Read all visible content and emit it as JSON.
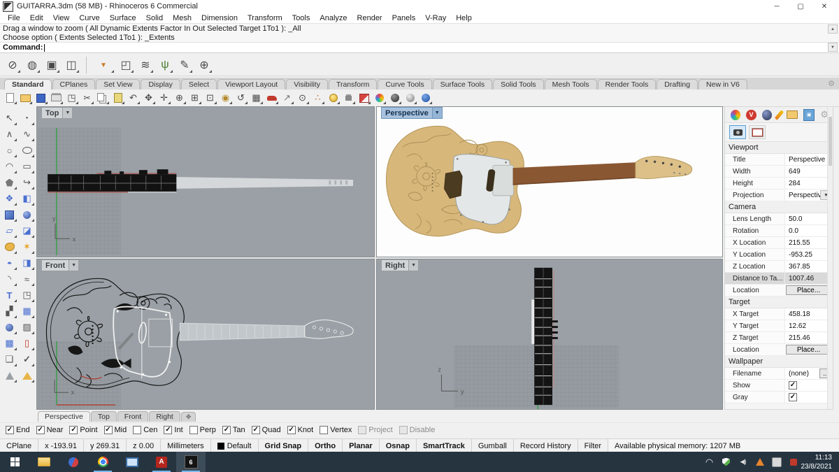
{
  "window": {
    "title": "GUITARRA.3dm (58 MB) - Rhinoceros 6 Commercial"
  },
  "menu": {
    "items": [
      "File",
      "Edit",
      "View",
      "Curve",
      "Surface",
      "Solid",
      "Mesh",
      "Dimension",
      "Transform",
      "Tools",
      "Analyze",
      "Render",
      "Panels",
      "V-Ray",
      "Help"
    ]
  },
  "command": {
    "history_line1": "Drag a window to zoom ( All Dynamic Extents Factor In Out Selected Target 1To1 ): _All",
    "history_line2": "Choose option ( Extents Selected 1To1 ): _Extents",
    "prompt": "Command:"
  },
  "toolbar_tabs": {
    "active": "Standard",
    "items": [
      "Standard",
      "CPlanes",
      "Set View",
      "Display",
      "Select",
      "Viewport Layout",
      "Visibility",
      "Transform",
      "Curve Tools",
      "Surface Tools",
      "Solid Tools",
      "Mesh Tools",
      "Render Tools",
      "Drafting",
      "New in V6"
    ]
  },
  "toolbar1": {
    "icons": [
      "circle-slash",
      "render-teapot",
      "render-frame",
      "viewport-display",
      "selection-filter",
      "box-edit",
      "workbench",
      "grass",
      "pen",
      "zoom-target"
    ]
  },
  "toolbar2": {
    "icons": [
      "new-file",
      "open-file",
      "save",
      "print",
      "export",
      "cut",
      "copy",
      "paste",
      "undo",
      "pan",
      "move",
      "zoom-extents",
      "zoom-window",
      "zoom-selected",
      "zoom-lens",
      "rotate-view",
      "viewport-layout",
      "named-view",
      "distance",
      "circle-center",
      "point-analysis",
      "lamp",
      "lock",
      "vray-box",
      "color-wheel",
      "sphere-dark",
      "sphere-gray",
      "sphere-blue"
    ]
  },
  "left_toolbar": {
    "rows": [
      [
        "select",
        "point"
      ],
      [
        "polyline",
        "curve"
      ],
      [
        "circle",
        "ellipse"
      ],
      [
        "arc",
        "rectangle"
      ],
      [
        "polygon",
        "helix"
      ],
      [
        "surface-points",
        "surface-blend"
      ],
      [
        "box",
        "sphere"
      ],
      [
        "plane",
        "patch"
      ],
      [
        "blob",
        "splash"
      ],
      [
        "extrude",
        "extrude-surface"
      ],
      [
        "fillet",
        "blend"
      ],
      [
        "text",
        "move-points"
      ],
      [
        "blocks",
        "array"
      ],
      [
        "solid-union",
        "hatch"
      ],
      [
        "grid-panel",
        "clamp"
      ],
      [
        "layers",
        "check"
      ],
      [
        "cone",
        "pyramid"
      ]
    ]
  },
  "viewports": {
    "top": {
      "label": "Top"
    },
    "perspective": {
      "label": "Perspective"
    },
    "front": {
      "label": "Front"
    },
    "right": {
      "label": "Right"
    }
  },
  "panel": {
    "tabs": [
      "properties",
      "vray",
      "display",
      "notes",
      "libraries",
      "rendering"
    ],
    "viewport": {
      "title": "Viewport",
      "rows": [
        {
          "label": "Title",
          "value": "Perspective"
        },
        {
          "label": "Width",
          "value": "649"
        },
        {
          "label": "Height",
          "value": "284"
        },
        {
          "label": "Projection",
          "value": "Perspective"
        }
      ]
    },
    "camera": {
      "title": "Camera",
      "rows": [
        {
          "label": "Lens Length",
          "value": "50.0"
        },
        {
          "label": "Rotation",
          "value": "0.0"
        },
        {
          "label": "X Location",
          "value": "215.55"
        },
        {
          "label": "Y Location",
          "value": "-953.25"
        },
        {
          "label": "Z Location",
          "value": "367.85"
        },
        {
          "label": "Distance to Ta...",
          "value": "1007.46"
        },
        {
          "label": "Location",
          "value": "Place..."
        }
      ]
    },
    "target": {
      "title": "Target",
      "rows": [
        {
          "label": "X Target",
          "value": "458.18"
        },
        {
          "label": "Y Target",
          "value": "12.62"
        },
        {
          "label": "Z Target",
          "value": "215.46"
        },
        {
          "label": "Location",
          "value": "Place..."
        }
      ]
    },
    "wallpaper": {
      "title": "Wallpaper",
      "rows": [
        {
          "label": "Filename",
          "value": "(none)",
          "more": "..."
        },
        {
          "label": "Show",
          "checked": true
        },
        {
          "label": "Gray",
          "checked": true
        }
      ]
    }
  },
  "viewport_tabs": {
    "items": [
      {
        "label": "Perspective",
        "active": true
      },
      {
        "label": "Top",
        "active": false
      },
      {
        "label": "Front",
        "active": false
      },
      {
        "label": "Right",
        "active": false
      }
    ]
  },
  "osnap": {
    "items": [
      {
        "label": "End",
        "checked": true
      },
      {
        "label": "Near",
        "checked": true
      },
      {
        "label": "Point",
        "checked": true
      },
      {
        "label": "Mid",
        "checked": true
      },
      {
        "label": "Cen",
        "checked": false
      },
      {
        "label": "Int",
        "checked": true
      },
      {
        "label": "Perp",
        "checked": false
      },
      {
        "label": "Tan",
        "checked": true
      },
      {
        "label": "Quad",
        "checked": true
      },
      {
        "label": "Knot",
        "checked": true
      },
      {
        "label": "Vertex",
        "checked": false
      },
      {
        "label": "Project",
        "checked": false,
        "disabled": true
      },
      {
        "label": "Disable",
        "checked": false,
        "disabled": true
      }
    ]
  },
  "statusbar": {
    "items": [
      {
        "label": "CPlane"
      },
      {
        "label": "x -193.91"
      },
      {
        "label": "y 269.31"
      },
      {
        "label": "z 0.00"
      },
      {
        "label": "Millimeters"
      },
      {
        "label": "Default",
        "swatch": true
      },
      {
        "label": "Grid Snap",
        "bold": true
      },
      {
        "label": "Ortho",
        "bold": true
      },
      {
        "label": "Planar",
        "bold": true
      },
      {
        "label": "Osnap",
        "bold": true
      },
      {
        "label": "SmartTrack",
        "bold": true
      },
      {
        "label": "Gumball"
      },
      {
        "label": "Record History"
      },
      {
        "label": "Filter"
      },
      {
        "label": "Available physical memory: 1207 MB",
        "grow": true
      }
    ]
  },
  "taskbar": {
    "apps": [
      {
        "name": "start"
      },
      {
        "name": "explorer"
      },
      {
        "name": "media"
      },
      {
        "name": "chrome",
        "open": true
      },
      {
        "name": "remote"
      },
      {
        "name": "acrobat",
        "open": true
      },
      {
        "name": "rhino",
        "open": true,
        "active": true
      }
    ],
    "tray": [
      "wifi",
      "defender",
      "volume",
      "vlc",
      "notes",
      "alert"
    ],
    "clock": {
      "time": "11:13",
      "date": "23/8/2021"
    }
  }
}
